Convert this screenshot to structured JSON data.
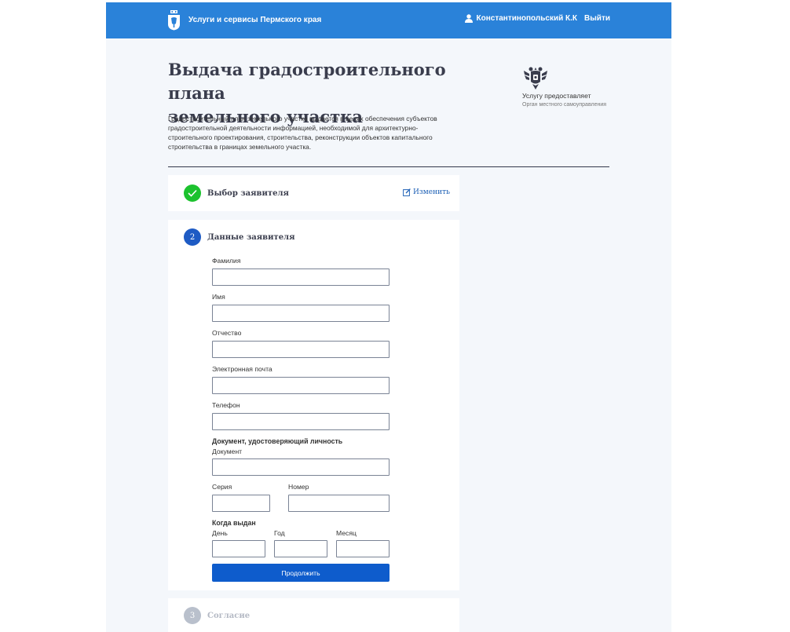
{
  "header": {
    "brand": "Услуги и сервисы Пермского края",
    "user_name": "Константинопольский К.К",
    "logout": "Выйти",
    "bar_color": "#2a82d9"
  },
  "service": {
    "title_line1": "Выдача градостроительного плана",
    "title_line2": "земельного участка",
    "description": "Градостроительный план земельного участка выдается в целях обеспечения субъектов градостроительной деятельности информацией, необходимой для архитектурно-строительного проектирования, строительства, реконструкции объектов капитального строительства в границах земельного участка."
  },
  "provider": {
    "title": "Услугу предоставляет",
    "subtitle": "Орган местного самоуправления"
  },
  "steps": [
    {
      "number": "1",
      "title": "Выбор заявителя",
      "status": "done",
      "edit_label": "Изменить"
    },
    {
      "number": "2",
      "title": "Данные заявителя",
      "status": "active"
    },
    {
      "number": "3",
      "title": "Согласие",
      "status": "pending"
    }
  ],
  "form": {
    "last_name_label": "Фамилия",
    "last_name_value": "",
    "first_name_label": "Имя",
    "first_name_value": "",
    "middle_name_label": "Отчество",
    "middle_name_value": "",
    "email_label": "Электронная почта",
    "email_value": "",
    "phone_label": "Телефон",
    "phone_value": "",
    "identity_section": "Документ, удостоверяющий личность",
    "document_label": "Документ",
    "document_value": "",
    "series_label": "Серия",
    "series_value": "",
    "number_label": "Номер",
    "number_value": "",
    "issued_section": "Когда выдан",
    "day_label": "День",
    "day_value": "",
    "year_label": "Год",
    "year_value": "",
    "month_label": "Месяц",
    "month_value": "",
    "submit_label": "Продолжить"
  },
  "colors": {
    "accent": "#0e5ccc",
    "done": "#1cc22e",
    "active": "#1e5bc4",
    "pending": "#b9c0cc"
  },
  "icons": [
    "perm-crest-icon",
    "user-icon",
    "russia-eagle-icon",
    "check-icon",
    "edit-icon"
  ]
}
